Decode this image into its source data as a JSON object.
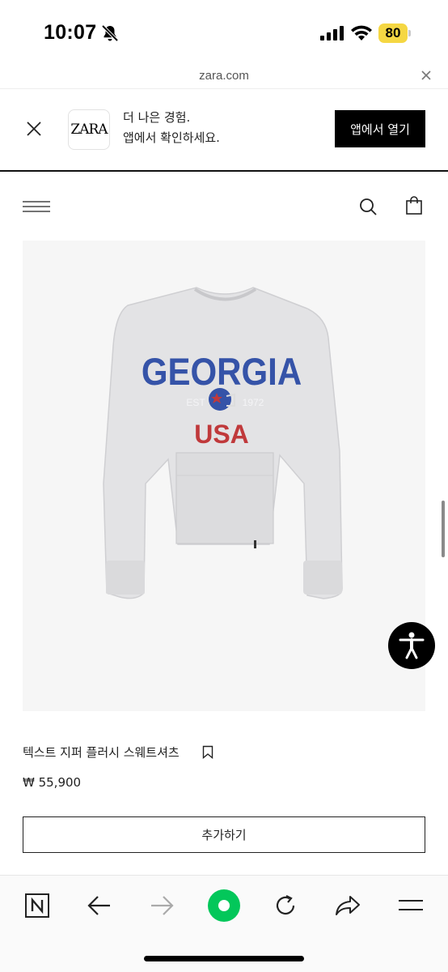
{
  "status_bar": {
    "time": "10:07",
    "battery": "80",
    "battery_color": "#f5d743",
    "icons": [
      "bell-slash-icon",
      "cellular-signal-icon",
      "wifi-icon",
      "battery-icon"
    ]
  },
  "url_bar": {
    "url": "zara.com"
  },
  "app_banner": {
    "logo": "ZARA",
    "line1": "더 나은 경험.",
    "line2": "앱에서 확인하세요.",
    "open_button": "앱에서 열기"
  },
  "header": {
    "icons": [
      "hamburger-menu-icon",
      "search-icon",
      "shopping-bag-icon"
    ]
  },
  "product": {
    "image_alt": "Grey sweatshirt with GEORGIA USA print",
    "print_main": "GEORGIA",
    "print_est": "EST",
    "print_year": "1972",
    "print_country": "USA",
    "name": "텍스트 지퍼 플러시 스웨트셔츠",
    "price": "₩ 55,900",
    "add_button": "추가하기"
  },
  "bottom_toolbar": {
    "icons": [
      "naver-n-icon",
      "back-arrow-icon",
      "forward-arrow-icon",
      "green-home-icon",
      "reload-icon",
      "share-icon",
      "menu-icon"
    ],
    "accent": "#03c75a"
  }
}
